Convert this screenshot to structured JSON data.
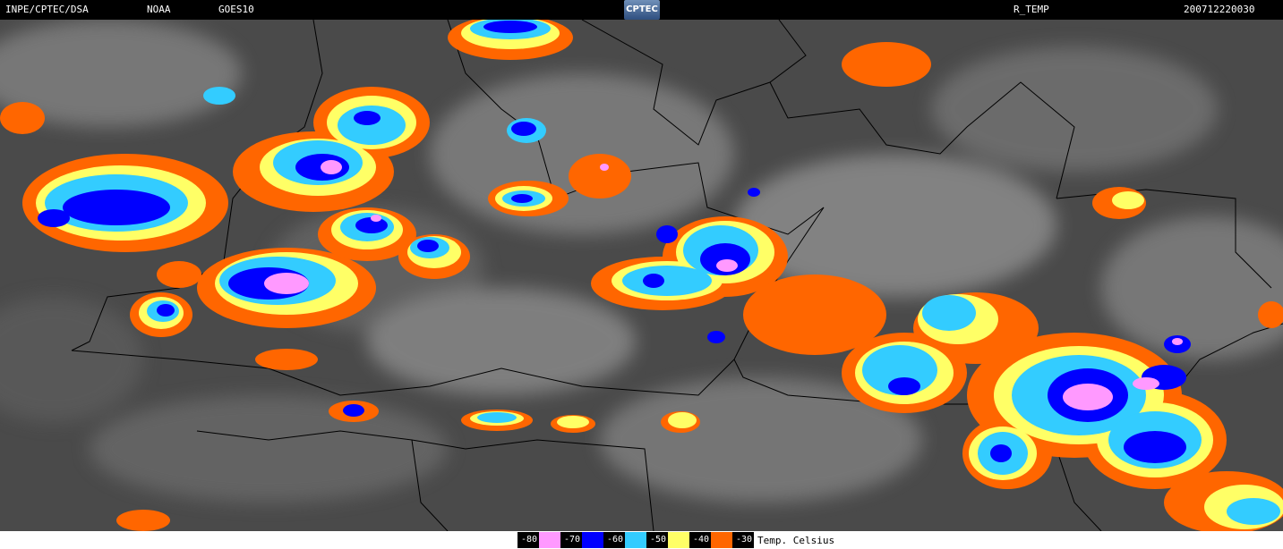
{
  "header": {
    "institution": "INPE/CPTEC/DSA",
    "agency": "NOAA",
    "satellite": "GOES10",
    "logo_text": "CPTEC",
    "product": "R_TEMP",
    "timestamp": "200712220030"
  },
  "legend": {
    "items": [
      {
        "label": "-80",
        "color": "#000000",
        "text_color": "#ffffff"
      },
      {
        "label": "",
        "color": "#ff99ff"
      },
      {
        "label": "-70",
        "color": "#000000",
        "text_color": "#ffffff"
      },
      {
        "label": "",
        "color": "#0000ff"
      },
      {
        "label": "-60",
        "color": "#000000",
        "text_color": "#ffffff"
      },
      {
        "label": "",
        "color": "#33ccff"
      },
      {
        "label": "-50",
        "color": "#000000",
        "text_color": "#ffffff"
      },
      {
        "label": "",
        "color": "#ffff66"
      },
      {
        "label": "-40",
        "color": "#000000",
        "text_color": "#ffffff"
      },
      {
        "label": "",
        "color": "#ff6600"
      },
      {
        "label": "-30",
        "color": "#000000",
        "text_color": "#ffffff"
      }
    ],
    "unit": "Temp. Celsius"
  },
  "colors": {
    "background_map": "#4a4a4a",
    "cloud_gray": "#9a9a9a",
    "cold_orange": "#ff6600",
    "cold_yellow": "#ffff66",
    "cold_cyan": "#33ccff",
    "cold_blue": "#0000ff",
    "cold_pink": "#ff99ff",
    "border_line": "#000000"
  }
}
